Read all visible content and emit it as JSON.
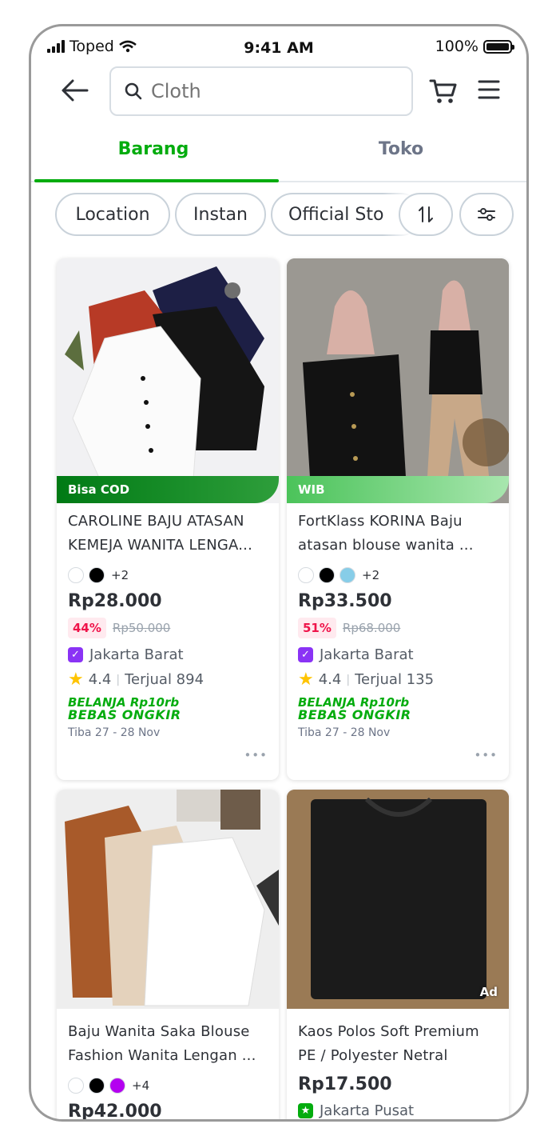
{
  "status_bar": {
    "carrier": "Toped",
    "time": "9:41 AM",
    "battery": "100%"
  },
  "search": {
    "value": "",
    "placeholder": "Cloth"
  },
  "tabs": [
    {
      "label": "Barang",
      "active": true
    },
    {
      "label": "Toko",
      "active": false
    }
  ],
  "filters": {
    "chips": [
      "Location",
      "Instan",
      "Official Sto"
    ]
  },
  "colors": {
    "brand": "#03ac0e",
    "text": "#2e3137",
    "muted": "#6d7588",
    "discount_bg": "#ffeaef",
    "discount_text": "#ef144a",
    "border": "#c9d2da"
  },
  "icons": {
    "back": "arrow-left-icon",
    "search": "search-icon",
    "cart": "cart-icon",
    "menu": "hamburger-menu-icon",
    "sort": "sort-icon",
    "filter": "filter-sliders-icon",
    "star": "star-icon",
    "more": "more-dots-icon"
  },
  "products": [
    {
      "ribbon": "Bisa COD",
      "title_line1": "CAROLINE BAJU ATASAN",
      "title_line2": "KEMEJA WANITA LENGA...",
      "swatch_colors": [
        "#ffffff",
        "#000000"
      ],
      "more_colors": "+2",
      "price": "Rp28.000",
      "discount": "44%",
      "original_price": "Rp50.000",
      "location": "Jakarta Barat",
      "rating": "4.4",
      "sold": "Terjual 894",
      "promo_line1": "BELANJA Rp10rb",
      "promo_line2": "BEBAS ONGKIR",
      "eta": "Tiba 27 - 28 Nov"
    },
    {
      "ribbon": "WIB",
      "title_line1": "FortKlass KORINA Baju",
      "title_line2": "atasan blouse wanita ...",
      "swatch_colors": [
        "#ffffff",
        "#000000",
        "#87cde8"
      ],
      "more_colors": "+2",
      "price": "Rp33.500",
      "discount": "51%",
      "original_price": "Rp68.000",
      "location": "Jakarta Barat",
      "rating": "4.4",
      "sold": "Terjual 135",
      "promo_line1": "BELANJA Rp10rb",
      "promo_line2": "BEBAS ONGKIR",
      "eta": "Tiba 27 - 28 Nov"
    },
    {
      "title_line1": "Baju Wanita Saka Blouse",
      "title_line2": "Fashion Wanita Lengan ...",
      "swatch_colors": [
        "#ffffff",
        "#000000",
        "#b400f0"
      ],
      "more_colors": "+4",
      "price": "Rp42.000"
    },
    {
      "ad_label": "Ad",
      "title_line1": "Kaos Polos Soft Premium",
      "title_line2": "PE / Polyester Netral",
      "price": "Rp17.500",
      "location": "Jakarta Pusat"
    }
  ]
}
